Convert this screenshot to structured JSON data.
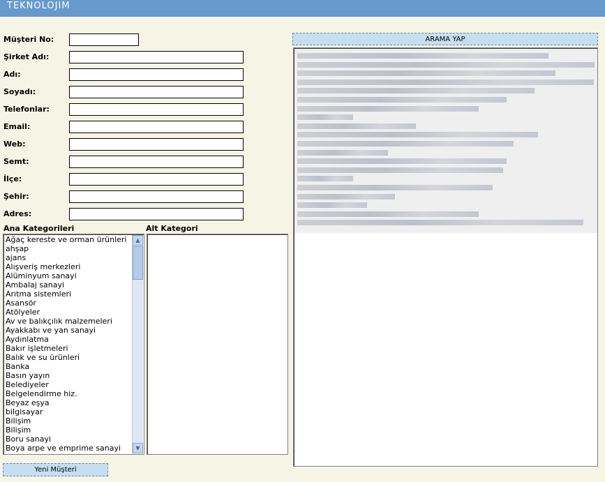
{
  "header": {
    "logo": "TEKNOLOJIM",
    "bg_color": "#6699cc"
  },
  "form": {
    "fields": [
      {
        "label": "Müşteri No:",
        "value": ""
      },
      {
        "label": "Şirket Adı:",
        "value": ""
      },
      {
        "label": "Adı:",
        "value": ""
      },
      {
        "label": "Soyadı:",
        "value": ""
      },
      {
        "label": "Telefonlar:",
        "value": ""
      },
      {
        "label": "Email:",
        "value": ""
      },
      {
        "label": "Web:",
        "value": ""
      },
      {
        "label": "Semt:",
        "value": ""
      },
      {
        "label": "İlçe:",
        "value": ""
      },
      {
        "label": "Şehir:",
        "value": ""
      },
      {
        "label": "Adres:",
        "value": ""
      }
    ]
  },
  "categories": {
    "main_label": "Ana Kategorileri",
    "sub_label": "Alt Kategori",
    "main_items": [
      "Ağaç kereste ve orman ürünleri",
      "ahşap",
      "ajans",
      "Alışveriş merkezleri",
      "Alüminyum sanayi",
      "Ambalaj sanayi",
      "Arıtma sistemleri",
      "Asansör",
      "Atölyeler",
      "Av ve balıkçılık malzemeleri",
      "Ayakkabı ve yan sanayi",
      "Aydınlatma",
      "Bakır işletmeleri",
      "Balık ve su ürünleri",
      "Banka",
      "Basın yayın",
      "Belediyeler",
      "Belgelendirme hiz.",
      "Beyaz eşya",
      "bilgisayar",
      "Bilişim",
      "Bilişim",
      "Boru sanayi",
      "Boya arpe ve emprime sanayi"
    ],
    "sub_items": []
  },
  "search": {
    "button_label": "ARAMA YAP"
  },
  "actions": {
    "new_customer_label": "Yeni Müşteri"
  }
}
